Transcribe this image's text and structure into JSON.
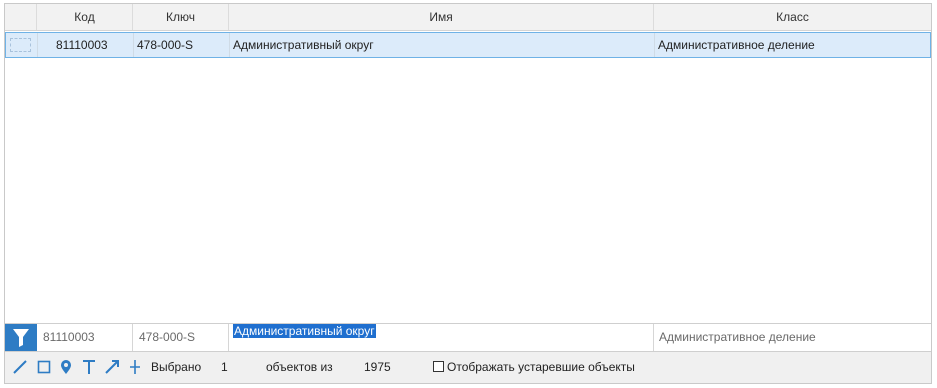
{
  "table": {
    "columns": [
      "Код",
      "Ключ",
      "Имя",
      "Класс"
    ],
    "rows": [
      {
        "code": "81110003",
        "key": "478-000-S",
        "name": "Административный округ",
        "class": "Административное деление"
      }
    ]
  },
  "filter_row": {
    "code": "81110003",
    "key": "478-000-S",
    "name": "Административный округ",
    "class": "Административное деление"
  },
  "status": {
    "selected_label": "Выбрано",
    "selected_count": "1",
    "of_label": "объектов из",
    "total": "1975",
    "show_obsolete_label": "Отображать устаревшие объекты",
    "show_obsolete_checked": false
  },
  "tools": [
    "line-icon",
    "rectangle-icon",
    "pin-icon",
    "text-icon",
    "arrow-icon",
    "cross-icon"
  ],
  "colors": {
    "accent": "#2e7cc4",
    "selection_bg": "#dcebfa",
    "selection_border": "#6fb2e6",
    "text_highlight": "#1f6fcf"
  }
}
